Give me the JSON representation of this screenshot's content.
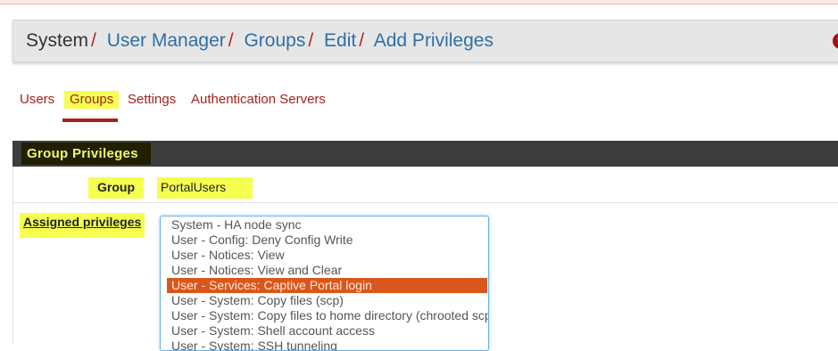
{
  "breadcrumb": {
    "root": "System",
    "items": [
      "User Manager",
      "Groups",
      "Edit",
      "Add Privileges"
    ],
    "separator": "/"
  },
  "help_icon": "question-circle-icon",
  "tabs": [
    {
      "label": "Users",
      "active": false
    },
    {
      "label": "Groups",
      "active": true
    },
    {
      "label": "Settings",
      "active": false
    },
    {
      "label": "Authentication Servers",
      "active": false
    }
  ],
  "panel": {
    "title": "Group Privileges",
    "group_label": "Group",
    "group_value": "PortalUsers",
    "assigned_label": "Assigned privileges",
    "privileges": [
      {
        "label": "System - HA node sync",
        "selected": false
      },
      {
        "label": "User - Config: Deny Config Write",
        "selected": false
      },
      {
        "label": "User - Notices: View",
        "selected": false
      },
      {
        "label": "User - Notices: View and Clear",
        "selected": false
      },
      {
        "label": "User - Services: Captive Portal login",
        "selected": true
      },
      {
        "label": "User - System: Copy files (scp)",
        "selected": false
      },
      {
        "label": "User - System: Copy files to home directory (chrooted scp)",
        "selected": false
      },
      {
        "label": "User - System: Shell account access",
        "selected": false
      },
      {
        "label": "User - System: SSH tunneling",
        "selected": false
      }
    ]
  },
  "colors": {
    "link": "#2f6fa8",
    "tab": "#a4231a",
    "selected_option": "#d9571d",
    "highlight": "#f5ff4f",
    "panel_header": "#3d3d3d"
  }
}
